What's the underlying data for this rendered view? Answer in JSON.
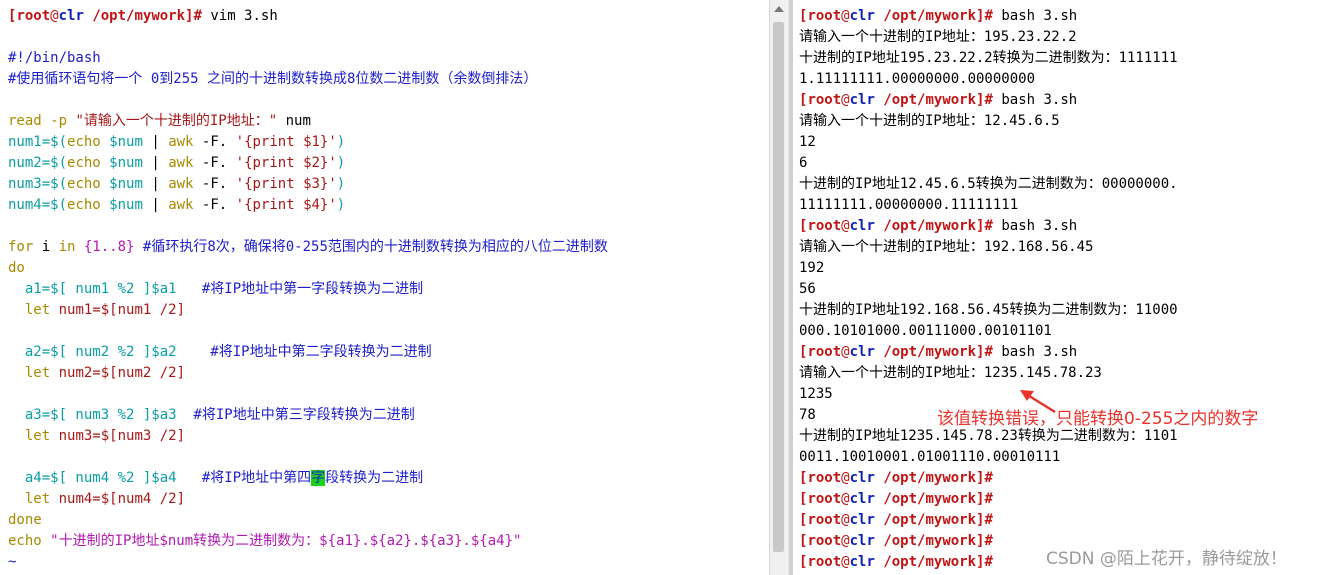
{
  "colors": {
    "prompt_red": "#c01414",
    "prompt_blue": "#0c1fb8",
    "comment": "#1e20c8",
    "keyword": "#a68a00",
    "variable": "#0a9ea5",
    "string": "#b01ab0",
    "annotation": "#e8332b",
    "highlight": "#1bd21b"
  },
  "prompt": {
    "open": "[",
    "user": "root",
    "at": "@",
    "host": "clr",
    "path": "/opt/mywork",
    "close": "]#"
  },
  "editor": {
    "cmd": " vim 3.sh",
    "shebang": "#!/bin/bash",
    "desc_comment": "#使用循环语句将一个 0到255 之间的十进制数转换成8位数二进制数（余数倒排法）",
    "read": {
      "kw": "read -p ",
      "str": "\"请输入一个十进制的IP地址：\"",
      "arg": " num"
    },
    "nums": [
      {
        "lhs": "num1=$(",
        "echo": "echo",
        "var": " $num",
        "pipe": " | ",
        "awk": "awk",
        "opt": " -F. ",
        "q": "'{print $1}'",
        "close": ")"
      },
      {
        "lhs": "num2=$(",
        "echo": "echo",
        "var": " $num",
        "pipe": " | ",
        "awk": "awk",
        "opt": " -F. ",
        "q": "'{print $2}'",
        "close": ")"
      },
      {
        "lhs": "num3=$(",
        "echo": "echo",
        "var": " $num",
        "pipe": " | ",
        "awk": "awk",
        "opt": " -F. ",
        "q": "'{print $3}'",
        "close": ")"
      },
      {
        "lhs": "num4=$(",
        "echo": "echo",
        "var": " $num",
        "pipe": " | ",
        "awk": "awk",
        "opt": " -F. ",
        "q": "'{print $4}'",
        "close": ")"
      }
    ],
    "for": {
      "kw1": "for",
      "v": " i ",
      "kw2": "in",
      "range": " {1..8}",
      "cmt": " #循环执行8次，确保将0-255范围内的十进制数转换为相应的八位二进制数"
    },
    "do": "do",
    "blocks": [
      {
        "a": "  a1=$[ num1 %2 ]$a1",
        "cmt": "   #将IP地址中第一字段转换为二进制",
        "let": "  let",
        "letv": " num1=$[num1 /2]"
      },
      {
        "a": "  a2=$[ num2 %2 ]$a2",
        "cmt": "    #将IP地址中第二字段转换为二进制",
        "let": "  let",
        "letv": " num2=$[num2 /2]"
      },
      {
        "a": "  a3=$[ num3 %2 ]$a3",
        "cmt": "  #将IP地址中第三字段转换为二进制",
        "let": "  let",
        "letv": " num3=$[num3 /2]"
      }
    ],
    "block4": {
      "a": "  a4=$[ num4 %2 ]$a4",
      "cmt_pre": "   #将IP地址中第四",
      "cmt_hl": "字",
      "cmt_post": "段转换为二进制",
      "let": "  let",
      "letv": " num4=$[num4 /2]"
    },
    "done": "done",
    "echo": {
      "kw": "echo ",
      "str": "\"十进制的IP地址$num转换为二进制数为：${a1}.${a2}.${a3}.${a4}\""
    },
    "tilde": "~"
  },
  "terminal": {
    "cmd": " bash 3.sh",
    "runs": [
      {
        "input": "请输入一个十进制的IP地址：195.23.22.2",
        "out": [],
        "result": [
          "十进制的IP地址195.23.22.2转换为二进制数为：1111111",
          "1.11111111.00000000.00000000"
        ]
      },
      {
        "input": "请输入一个十进制的IP地址：12.45.6.5",
        "out": [
          "12",
          "6"
        ],
        "result": [
          "十进制的IP地址12.45.6.5转换为二进制数为：00000000.",
          "11111111.00000000.11111111"
        ]
      },
      {
        "input": "请输入一个十进制的IP地址：192.168.56.45",
        "out": [
          "192",
          "56"
        ],
        "result": [
          "十进制的IP地址192.168.56.45转换为二进制数为：11000",
          "000.10101000.00111000.00101101"
        ]
      },
      {
        "input": "请输入一个十进制的IP地址：1235.145.78.23",
        "out": [
          "1235",
          "78"
        ],
        "result": [
          "十进制的IP地址1235.145.78.23转换为二进制数为：1101",
          "0011.10010001.01001110.00010111"
        ]
      }
    ],
    "trailing_prompts": 5
  },
  "annotation": "该值转换错误，只能转换0-255之内的数字",
  "watermark": "CSDN @陌上花开，静待绽放！"
}
